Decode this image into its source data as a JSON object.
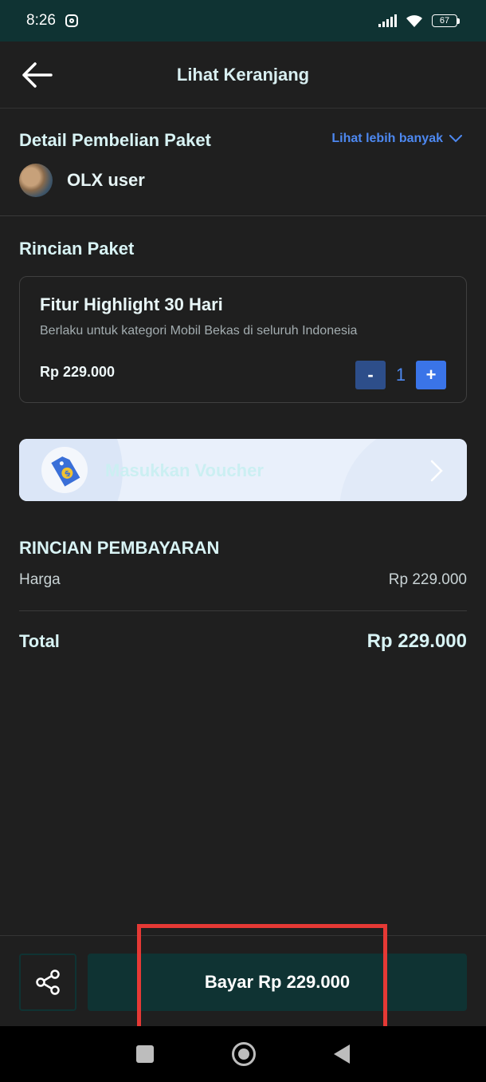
{
  "status_bar": {
    "time": "8:26",
    "battery": "67"
  },
  "header": {
    "title": "Lihat Keranjang"
  },
  "detail": {
    "title": "Detail Pembelian Paket",
    "see_more": "Lihat lebih banyak",
    "user_name": "OLX user"
  },
  "package": {
    "section_title": "Rincian Paket",
    "name": "Fitur Highlight 30 Hari",
    "description": "Berlaku untuk kategori Mobil Bekas di seluruh Indonesia",
    "price": "Rp 229.000",
    "quantity": "1",
    "minus_label": "-",
    "plus_label": "+"
  },
  "voucher": {
    "label": "Masukkan Voucher"
  },
  "payment": {
    "title": "RINCIAN PEMBAYARAN",
    "price_label": "Harga",
    "price_value": "Rp 229.000",
    "total_label": "Total",
    "total_value": "Rp 229.000"
  },
  "footer": {
    "pay_label": "Bayar Rp 229.000"
  },
  "colors": {
    "accent_blue": "#4d88f0",
    "primary_dark_teal": "#0f3333",
    "highlight_red": "#e53935",
    "background": "#1f1f1f"
  }
}
